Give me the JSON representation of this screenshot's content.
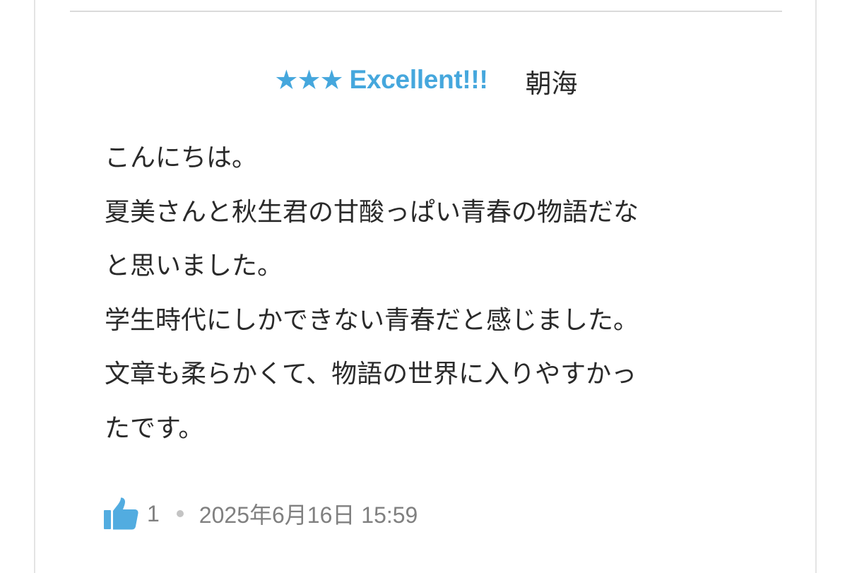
{
  "header": {
    "stars": "★★★",
    "rating_label": "Excellent!!!",
    "reviewer": "朝海"
  },
  "review": {
    "lines": [
      "こんにちは。",
      "夏美さんと秋生君の甘酸っぱい青春の物語だな",
      "と思いました。",
      "学生時代にしかできない青春だと感じました。",
      "文章も柔らかくて、物語の世界に入りやすかっ",
      "たです。"
    ]
  },
  "footer": {
    "like_icon": "thumbs-up-icon",
    "like_count": "1",
    "date": "2025年6月16日 15:59"
  },
  "colors": {
    "accent": "#45a7dd",
    "like_icon": "#52ace0",
    "text": "#2a2a2a",
    "meta": "#808080"
  }
}
